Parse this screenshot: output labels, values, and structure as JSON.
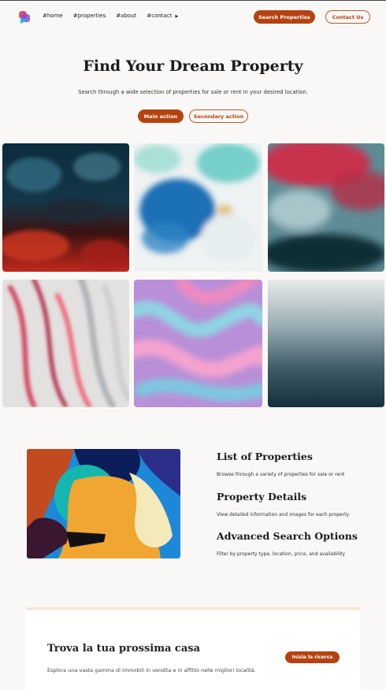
{
  "nav": {
    "links": [
      "#home",
      "#properties",
      "#about",
      "#contact"
    ],
    "search_button": "Search Properties",
    "contact_button": "Contact Us",
    "logo_colors": [
      "#e34b6a",
      "#7a4fe0",
      "#22b3e8"
    ]
  },
  "hero": {
    "title": "Find Your Dream Property",
    "subtitle": "Search through a wide selection of properties for sale or rent in your desired location.",
    "main_action": "Main action",
    "secondary_action": "Secondary action"
  },
  "gallery": {
    "tiles": [
      "abstract-dark-red-blue",
      "abstract-blue-splash",
      "abstract-red-teal",
      "abstract-pink-streaks",
      "abstract-pink-blue-marble",
      "abstract-misty-teal"
    ]
  },
  "features": [
    {
      "title": "List of Properties",
      "desc": "Browse through a variety of properties for sale or rent"
    },
    {
      "title": "Property Details",
      "desc": "View detailed information and images for each property"
    },
    {
      "title": "Advanced Search Options",
      "desc": "Filter by property type, location, price, and availability"
    }
  ],
  "cta": {
    "title": "Trova la tua prossima casa",
    "desc": "Esplora una vasta gamma di immobili in vendita e in affitto nelle migliori località.",
    "button": "Inizia la ricerca"
  },
  "colors": {
    "accent": "#b5420f",
    "background": "#faf8f6"
  }
}
